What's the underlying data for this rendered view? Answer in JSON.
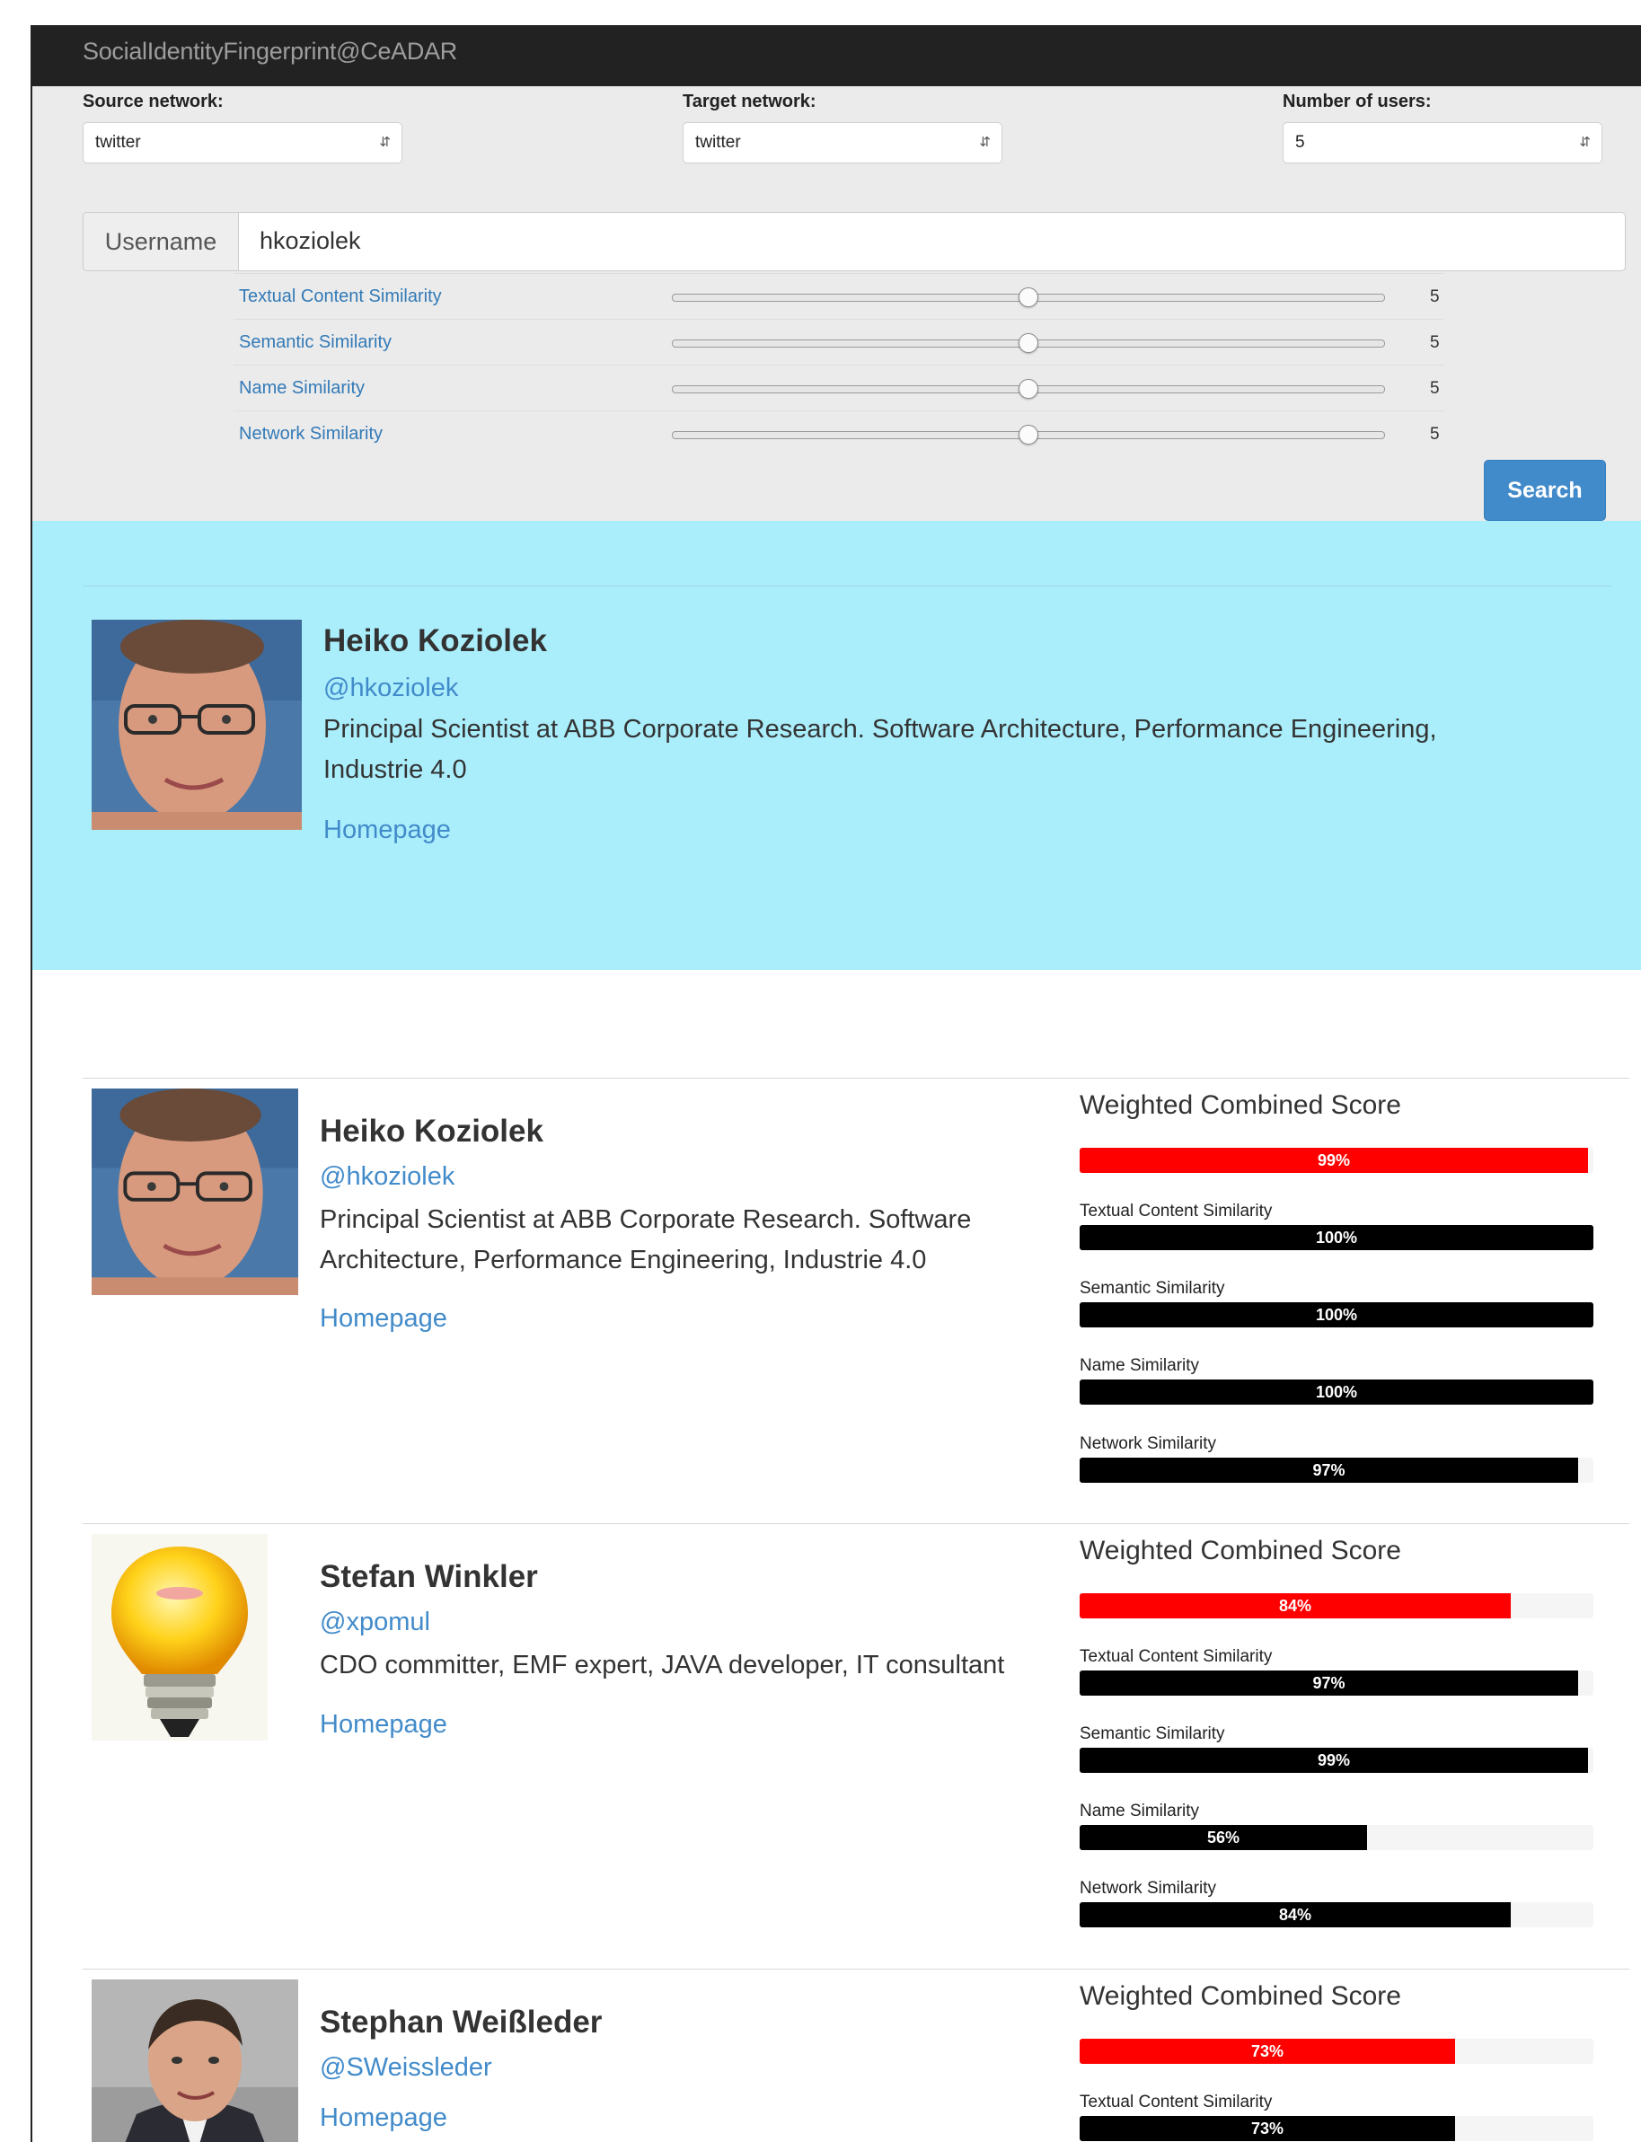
{
  "app": {
    "title": "SocialIdentityFingerprint@CeADAR"
  },
  "controls": {
    "source_label": "Source network:",
    "source_value": "twitter",
    "target_label": "Target network:",
    "target_value": "twitter",
    "users_label": "Number of users:",
    "users_value": "5",
    "username_label": "Username",
    "username_value": "hkoziolek",
    "sliders": [
      {
        "label": "Textual Content Similarity",
        "value": "5",
        "level": 0.5
      },
      {
        "label": "Semantic Similarity",
        "value": "5",
        "level": 0.5
      },
      {
        "label": "Name Similarity",
        "value": "5",
        "level": 0.5
      },
      {
        "label": "Network Similarity",
        "value": "5",
        "level": 0.5
      }
    ],
    "search_label": "Search"
  },
  "profile": {
    "name": "Heiko Koziolek",
    "handle": "@hkoziolek",
    "bio": "Principal Scientist at ABB Corporate Research. Software Architecture, Performance Engineering, Industrie 4.0",
    "homepage": "Homepage"
  },
  "colors": {
    "accent": "#428bca",
    "banner": "#aaeefc",
    "score_bar": "#ff0000",
    "metric_bar": "#000000"
  },
  "results": [
    {
      "name": "Heiko Koziolek",
      "handle": "@hkoziolek",
      "bio": "Principal Scientist at ABB Corporate Research. Software Architecture, Performance Engineering, Industrie 4.0",
      "homepage": "Homepage",
      "score_title": "Weighted Combined Score",
      "score": {
        "value": 99,
        "text": "99%"
      },
      "metrics": [
        {
          "label": "Textual Content Similarity",
          "value": 100,
          "text": "100%"
        },
        {
          "label": "Semantic Similarity",
          "value": 100,
          "text": "100%"
        },
        {
          "label": "Name Similarity",
          "value": 100,
          "text": "100%"
        },
        {
          "label": "Network Similarity",
          "value": 97,
          "text": "97%"
        }
      ]
    },
    {
      "name": "Stefan Winkler",
      "handle": "@xpomul",
      "bio": "CDO committer, EMF expert, JAVA developer, IT consultant",
      "homepage": "Homepage",
      "score_title": "Weighted Combined Score",
      "score": {
        "value": 84,
        "text": "84%"
      },
      "metrics": [
        {
          "label": "Textual Content Similarity",
          "value": 97,
          "text": "97%"
        },
        {
          "label": "Semantic Similarity",
          "value": 99,
          "text": "99%"
        },
        {
          "label": "Name Similarity",
          "value": 56,
          "text": "56%"
        },
        {
          "label": "Network Similarity",
          "value": 84,
          "text": "84%"
        }
      ]
    },
    {
      "name": "Stephan Weißleder",
      "handle": "@SWeissleder",
      "bio": "",
      "homepage": "Homepage",
      "score_title": "Weighted Combined Score",
      "score": {
        "value": 73,
        "text": "73%"
      },
      "metrics": [
        {
          "label": "Textual Content Similarity",
          "value": 73,
          "text": "73%"
        }
      ]
    }
  ]
}
